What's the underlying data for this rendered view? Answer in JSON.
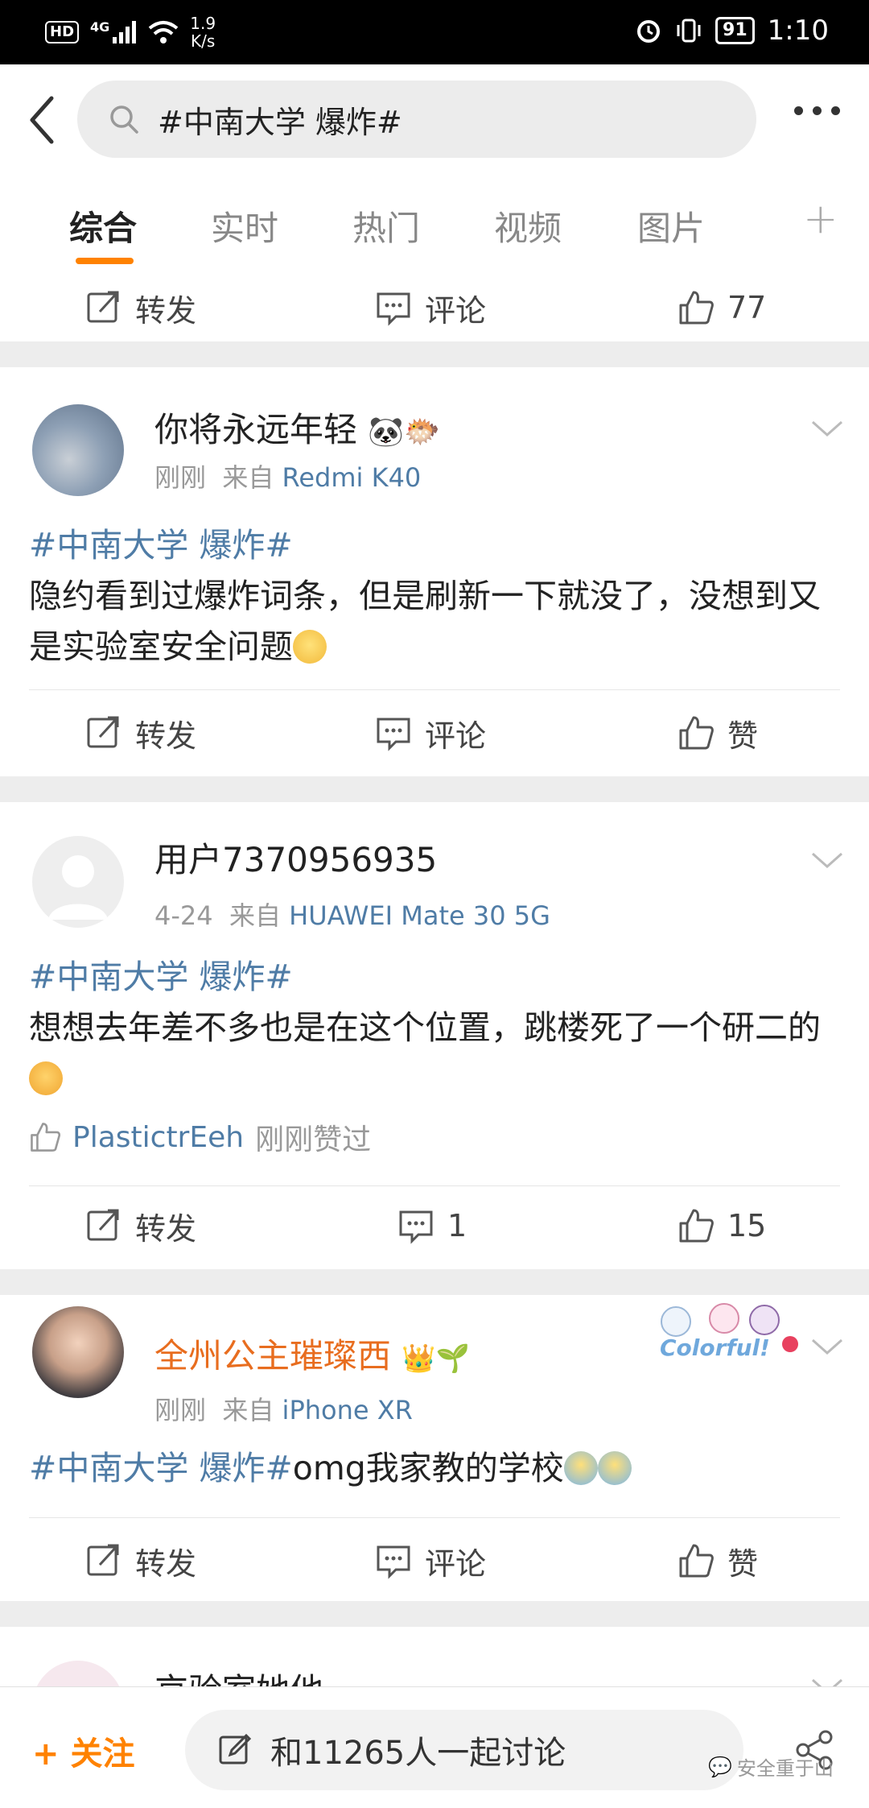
{
  "status_bar": {
    "network": "4G",
    "hd": "HD",
    "speed": "1.9\nK/s",
    "battery": "91",
    "time": "1:10"
  },
  "search": {
    "query": "#中南大学 爆炸#"
  },
  "tabs": [
    "综合",
    "实时",
    "热门",
    "视频",
    "图片"
  ],
  "top_action_bar": {
    "repost": "转发",
    "comment": "评论",
    "likes": "77"
  },
  "posts": [
    {
      "user": "你将永远年轻",
      "time": "刚刚",
      "from": "来自",
      "device": "Redmi K40",
      "topic": "#中南大学 爆炸#",
      "text": "隐约看到过爆炸词条，但是刷新一下就没了，没想到又是实验室安全问题",
      "repost": "转发",
      "comment": "评论",
      "like": "赞"
    },
    {
      "user": "用户7370956935",
      "time": "4-24",
      "from": "来自",
      "device": "HUAWEI Mate 30 5G",
      "topic": "#中南大学 爆炸#",
      "text": "想想去年差不多也是在这个位置，跳楼死了一个研二的",
      "liked_by": "PlastictrEeh",
      "liked_text": "刚刚赞过",
      "repost": "转发",
      "comment": "1",
      "like": "15"
    },
    {
      "user": "全州公主璀璨西",
      "time": "刚刚",
      "from": "来自",
      "device": "iPhone XR",
      "topic": "#中南大学 爆炸#",
      "text": "omg我家教的学校",
      "sticker": "Colorful!",
      "repost": "转发",
      "comment": "评论",
      "like": "赞"
    },
    {
      "user": "京验室她他"
    }
  ],
  "bottom_bar": {
    "follow": "+ 关注",
    "discuss": "和11265人一起讨论",
    "watermark": "安全重于山"
  },
  "colors": {
    "accent": "#ff8200",
    "link": "#4f7ca6",
    "vip_name": "#e86d1f"
  }
}
